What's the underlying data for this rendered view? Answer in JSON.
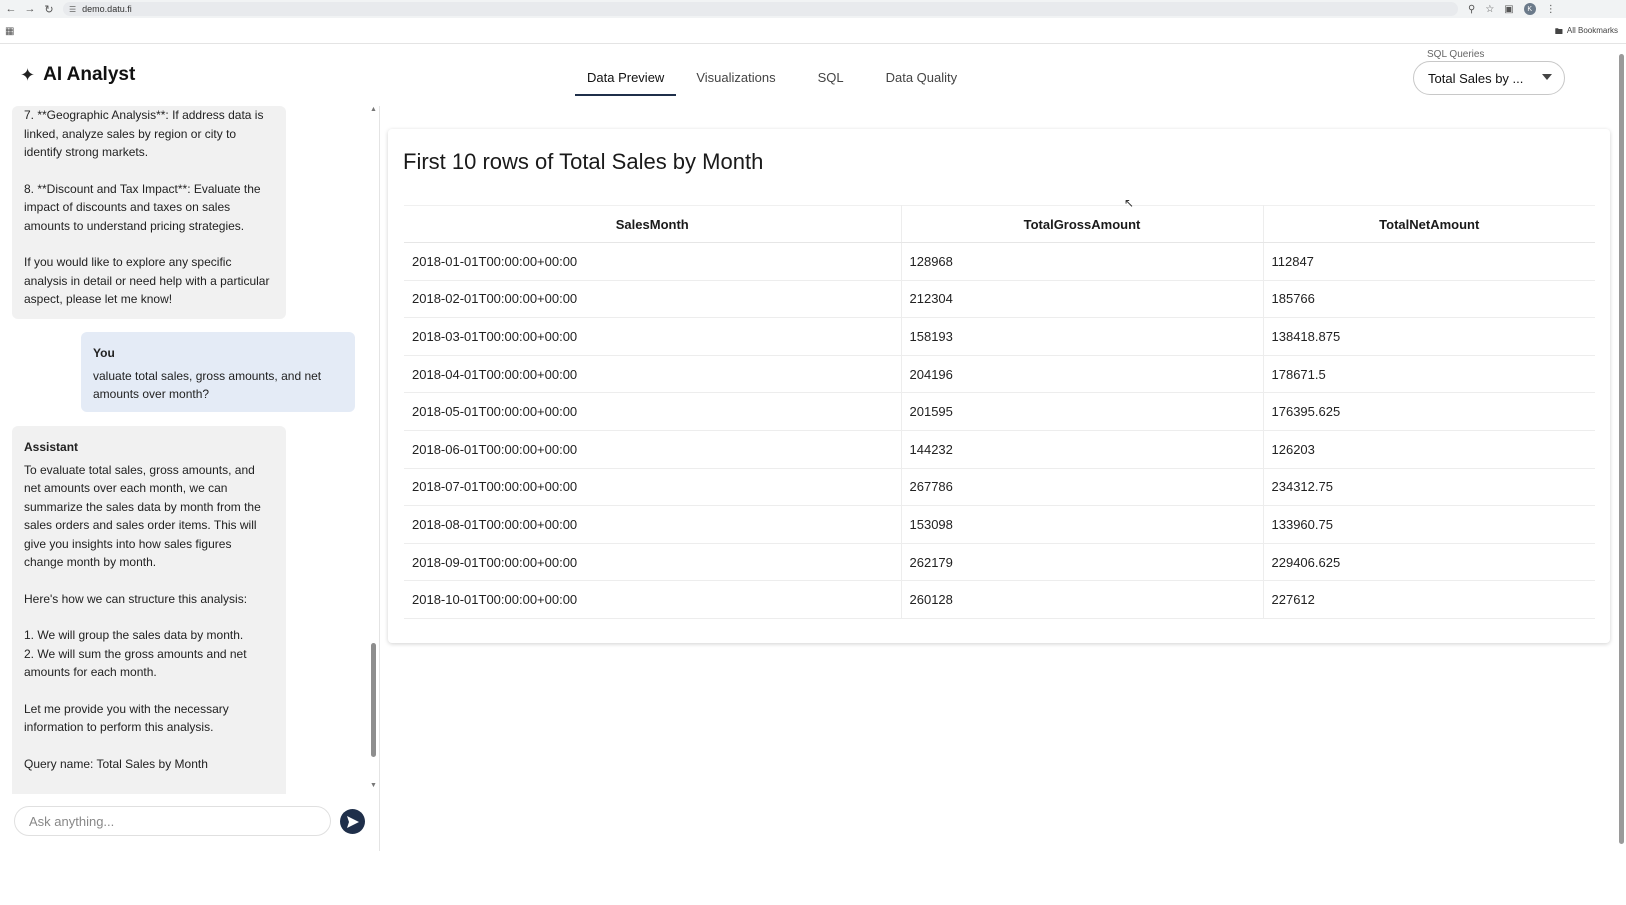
{
  "browser": {
    "url": "demo.datu.fi",
    "all_bookmarks": "All Bookmarks",
    "avatar_letter": "K"
  },
  "header": {
    "title": "AI Analyst",
    "tabs": [
      {
        "label": "Data Preview",
        "active": true
      },
      {
        "label": "Visualizations",
        "active": false
      },
      {
        "label": "SQL",
        "active": false
      },
      {
        "label": "Data Quality",
        "active": false
      }
    ],
    "sql_select": {
      "label": "SQL Queries",
      "value": "Total Sales by ..."
    }
  },
  "chat": {
    "messages": [
      {
        "role": "assistant",
        "paragraphs": [
          "7. **Geographic Analysis**: If address data is linked, analyze sales by region or city to identify strong markets.",
          "8. **Discount and Tax Impact**: Evaluate the impact of discounts and taxes on sales amounts to understand pricing strategies.",
          "If you would like to explore any specific analysis in detail or need help with a particular aspect, please let me know!"
        ]
      },
      {
        "role": "user",
        "author": "You",
        "text": "valuate total sales, gross amounts, and net amounts over month?"
      },
      {
        "role": "assistant",
        "author": "Assistant",
        "paragraphs": [
          "To evaluate total sales, gross amounts, and net amounts over each month, we can summarize the sales data by month from the sales orders and sales order items. This will give you insights into how sales figures change month by month.",
          "Here's how we can structure this analysis:",
          "1. We will group the sales data by month.\n2. We will sum the gross amounts and net amounts for each month.",
          "Let me provide you with the necessary information to perform this analysis.",
          "Query name: Total Sales by Month"
        ]
      }
    ],
    "input_placeholder": "Ask anything..."
  },
  "preview": {
    "title": "First 10 rows of Total Sales by Month",
    "columns": [
      "SalesMonth",
      "TotalGrossAmount",
      "TotalNetAmount"
    ],
    "rows": [
      [
        "2018-01-01T00:00:00+00:00",
        "128968",
        "112847"
      ],
      [
        "2018-02-01T00:00:00+00:00",
        "212304",
        "185766"
      ],
      [
        "2018-03-01T00:00:00+00:00",
        "158193",
        "138418.875"
      ],
      [
        "2018-04-01T00:00:00+00:00",
        "204196",
        "178671.5"
      ],
      [
        "2018-05-01T00:00:00+00:00",
        "201595",
        "176395.625"
      ],
      [
        "2018-06-01T00:00:00+00:00",
        "144232",
        "126203"
      ],
      [
        "2018-07-01T00:00:00+00:00",
        "267786",
        "234312.75"
      ],
      [
        "2018-08-01T00:00:00+00:00",
        "153098",
        "133960.75"
      ],
      [
        "2018-09-01T00:00:00+00:00",
        "262179",
        "229406.625"
      ],
      [
        "2018-10-01T00:00:00+00:00",
        "260128",
        "227612"
      ]
    ]
  },
  "colors": {
    "accent": "#1f2f4a",
    "user_bubble": "#e4ebf6",
    "assistant_bubble": "#f1f1f1"
  }
}
